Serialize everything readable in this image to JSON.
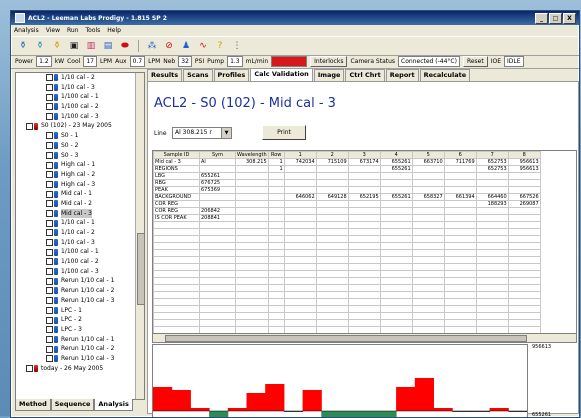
{
  "window": {
    "title": "ACL2 - Leeman Labs Prodigy - 1.815 SP 2",
    "controls": [
      "_",
      "□",
      "X"
    ]
  },
  "menu": [
    "Analysis",
    "View",
    "Run",
    "Tools",
    "Help"
  ],
  "status": {
    "power_label": "Power",
    "power_value": "1.2",
    "power_unit": "kW",
    "cool_label": "Cool",
    "cool_value": "17",
    "cool_unit": "LPM",
    "aux_label": "Aux",
    "aux_value": "0.7",
    "aux_unit": "LPM",
    "neb_label": "Neb",
    "neb_value": "32",
    "neb_unit": "PSI",
    "pump_label": "Pump",
    "pump_value": "1.3",
    "pump_unit": "mL/min",
    "interlocks_button": "Interlocks",
    "camera_label": "Camera Status",
    "camera_value": "Connected (-44°C)",
    "reset_button": "Reset",
    "ioe_label": "IOE",
    "ioe_value": "IDLE"
  },
  "tree": {
    "items": [
      {
        "label": "1/10 cal - 2",
        "level": 2,
        "color": "blue"
      },
      {
        "label": "1/10 cal - 3",
        "level": 2,
        "color": "blue"
      },
      {
        "label": "1/100 cal - 1",
        "level": 2,
        "color": "blue"
      },
      {
        "label": "1/100 cal - 2",
        "level": 2,
        "color": "blue"
      },
      {
        "label": "1/100 cal - 3",
        "level": 2,
        "color": "blue"
      },
      {
        "label": "S0 (102) - 23 May 2005",
        "level": 1,
        "color": "red"
      },
      {
        "label": "S0 - 1",
        "level": 2,
        "color": "blue"
      },
      {
        "label": "S0 - 2",
        "level": 2,
        "color": "blue"
      },
      {
        "label": "S0 - 3",
        "level": 2,
        "color": "blue"
      },
      {
        "label": "High cal - 1",
        "level": 2,
        "color": "blue"
      },
      {
        "label": "High cal - 2",
        "level": 2,
        "color": "blue"
      },
      {
        "label": "High cal - 3",
        "level": 2,
        "color": "blue"
      },
      {
        "label": "Mid cal - 1",
        "level": 2,
        "color": "blue"
      },
      {
        "label": "Mid cal - 2",
        "level": 2,
        "color": "blue"
      },
      {
        "label": "Mid cal - 3",
        "level": 2,
        "color": "blue",
        "selected": true
      },
      {
        "label": "1/10 cal - 1",
        "level": 2,
        "color": "blue"
      },
      {
        "label": "1/10 cal - 2",
        "level": 2,
        "color": "blue"
      },
      {
        "label": "1/10 cal - 3",
        "level": 2,
        "color": "blue"
      },
      {
        "label": "1/100 cal - 1",
        "level": 2,
        "color": "blue"
      },
      {
        "label": "1/100 cal - 2",
        "level": 2,
        "color": "blue"
      },
      {
        "label": "1/100 cal - 3",
        "level": 2,
        "color": "blue"
      },
      {
        "label": "Rerun 1/10 cal - 1",
        "level": 2,
        "color": "blue"
      },
      {
        "label": "Rerun 1/10 cal - 2",
        "level": 2,
        "color": "blue"
      },
      {
        "label": "Rerun 1/10 cal - 3",
        "level": 2,
        "color": "blue"
      },
      {
        "label": "LPC - 1",
        "level": 2,
        "color": "blue"
      },
      {
        "label": "LPC - 2",
        "level": 2,
        "color": "blue"
      },
      {
        "label": "LPC - 3",
        "level": 2,
        "color": "blue"
      },
      {
        "label": "Rerun 1/10 cal - 1",
        "level": 2,
        "color": "blue"
      },
      {
        "label": "Rerun 1/10 cal - 2",
        "level": 2,
        "color": "blue"
      },
      {
        "label": "Rerun 1/10 cal - 3",
        "level": 2,
        "color": "blue"
      },
      {
        "label": "today - 26 May 2005",
        "level": 1,
        "color": "red"
      }
    ]
  },
  "bottom_tabs": [
    "Method",
    "Sequence",
    "Analysis"
  ],
  "tabs": [
    "Results",
    "Scans",
    "Profiles",
    "Calc Validation",
    "Image",
    "Ctrl Chrt",
    "Report",
    "Recalculate"
  ],
  "active_tab": "Calc Validation",
  "content": {
    "title": "ACL2 - S0 (102) - Mid cal - 3",
    "line_label": "Line",
    "line_value": "Al 308.215 r",
    "print_button": "Print"
  },
  "grid": {
    "headers": [
      "Sample ID",
      "Sym",
      "Wavelength",
      "Row",
      "1",
      "2",
      "3",
      "4",
      "5",
      "6",
      "7",
      "8"
    ],
    "rows": [
      [
        "Mid cal - 3",
        "Al",
        "308.215",
        "1",
        "742034",
        "715109",
        "673174",
        "655261",
        "663710",
        "711769",
        "652753",
        "956613"
      ],
      [
        "REGIONS",
        "",
        "",
        "1",
        "",
        "",
        "",
        "655261",
        "",
        "",
        "652753",
        "956613"
      ],
      [
        "LBG",
        "655261",
        "",
        "",
        "",
        "",
        "",
        "",
        "",
        "",
        "",
        ""
      ],
      [
        "RBG",
        "676725",
        "",
        "",
        "",
        "",
        "",
        "",
        "",
        "",
        "",
        ""
      ],
      [
        "PEAK",
        "675369",
        "",
        "",
        "",
        "",
        "",
        "",
        "",
        "",
        "",
        ""
      ],
      [
        "BACKGROUND",
        "",
        "",
        "",
        "646062",
        "649128",
        "652195",
        "655261",
        "658327",
        "661394",
        "664460",
        "667526"
      ],
      [
        "COR REG",
        "",
        "",
        "",
        "",
        "",
        "",
        "",
        "",
        "",
        "188293",
        "269087"
      ],
      [
        "COR REG",
        "206842",
        "",
        "",
        "",
        "",
        "",
        "",
        "",
        "",
        "",
        ""
      ],
      [
        "IS COR PEAK",
        "208841",
        "",
        "",
        "",
        "",
        "",
        "",
        "",
        "",
        "",
        ""
      ]
    ]
  },
  "chart_data": {
    "type": "bar",
    "y_top_label": "956613",
    "y_bottom_label": "655261",
    "colors": {
      "high": "#ff0000",
      "low": "#2e8b57",
      "zero": "#000000"
    },
    "values": [
      0.4,
      0.35,
      0.05,
      -0.18,
      0.05,
      0.3,
      0.45,
      0.0,
      0.35,
      -0.3,
      -0.3,
      -0.3,
      -0.3,
      0.4,
      0.55,
      0.05,
      0.0,
      0.0,
      0.05,
      0.0
    ]
  }
}
